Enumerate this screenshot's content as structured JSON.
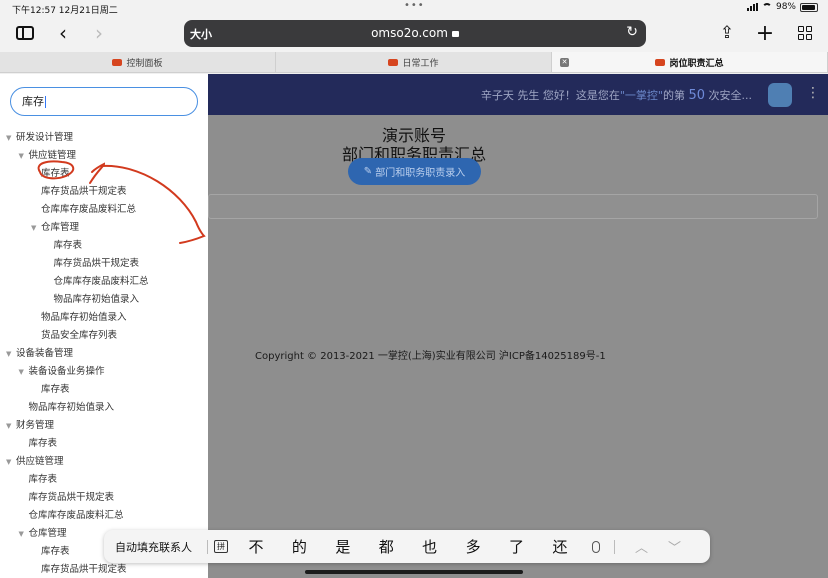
{
  "status_bar": {
    "time_date": "下午12:57   12月21日周二",
    "battery": "98%"
  },
  "toolbar": {
    "text_size": "大小",
    "url": "omso2o.com"
  },
  "tabs": [
    {
      "label": "控制面板"
    },
    {
      "label": "日常工作"
    },
    {
      "label": "岗位职责汇总"
    }
  ],
  "header": {
    "greeting_prefix": "辛子天 先生 您好！这是您在",
    "brand": "\"一掌控\"",
    "greeting_mid": "的第",
    "count": "50",
    "greeting_suffix": "次安全..."
  },
  "main": {
    "title_line1": "演示账号",
    "title_line2": "部门和职务职责汇总",
    "button_label": "部门和职务职责录入",
    "copyright": "Copyright © 2013-2021 一掌控(上海)实业有限公司 沪ICP备14025189号-1"
  },
  "sidebar": {
    "search_value": "库存",
    "tree": [
      {
        "label": "研发设计管理",
        "depth": 0,
        "expanded": true
      },
      {
        "label": "供应链管理",
        "depth": 1,
        "expanded": true
      },
      {
        "label": "库存表",
        "depth": 2
      },
      {
        "label": "库存货品烘干规定表",
        "depth": 2
      },
      {
        "label": "仓库库存废品废料汇总",
        "depth": 2
      },
      {
        "label": "仓库管理",
        "depth": 2,
        "expanded": true
      },
      {
        "label": "库存表",
        "depth": 3
      },
      {
        "label": "库存货品烘干规定表",
        "depth": 3
      },
      {
        "label": "仓库库存废品废料汇总",
        "depth": 3
      },
      {
        "label": "物品库存初始值录入",
        "depth": 3
      },
      {
        "label": "物品库存初始值录入",
        "depth": 2
      },
      {
        "label": "货品安全库存列表",
        "depth": 2
      },
      {
        "label": "设备装备管理",
        "depth": 0,
        "expanded": true
      },
      {
        "label": "装备设备业务操作",
        "depth": 1,
        "expanded": true
      },
      {
        "label": "库存表",
        "depth": 2
      },
      {
        "label": "物品库存初始值录入",
        "depth": 1
      },
      {
        "label": "财务管理",
        "depth": 0,
        "expanded": true
      },
      {
        "label": "库存表",
        "depth": 1
      },
      {
        "label": "供应链管理",
        "depth": 0,
        "expanded": true
      },
      {
        "label": "库存表",
        "depth": 1
      },
      {
        "label": "库存货品烘干规定表",
        "depth": 1
      },
      {
        "label": "仓库库存废品废料汇总",
        "depth": 1
      },
      {
        "label": "仓库管理",
        "depth": 1,
        "expanded": true
      },
      {
        "label": "库存表",
        "depth": 2
      },
      {
        "label": "库存货品烘干规定表",
        "depth": 2
      }
    ]
  },
  "keyboard_bar": {
    "autofill": "自动填充联系人",
    "pinyin_label": "拼",
    "candidates": [
      "不",
      "的",
      "是",
      "都",
      "也",
      "多",
      "了",
      "还"
    ]
  },
  "colors": {
    "header_bg": "#232a5a",
    "accent_blue": "#2e66b0",
    "annotation_red": "#d23a1e",
    "tab_favicon": "#d6451f"
  }
}
